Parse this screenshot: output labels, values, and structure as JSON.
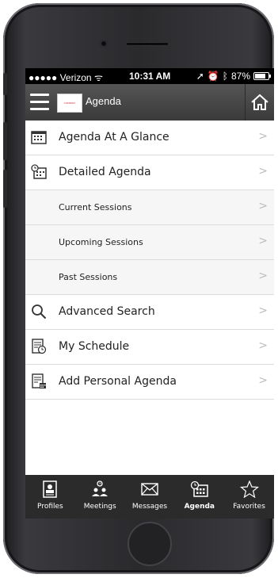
{
  "status_bar": {
    "carrier": "●●●●● Verizon",
    "time": "10:31 AM",
    "battery": "87%"
  },
  "header": {
    "title": "Agenda",
    "logo_text": "COMPANY"
  },
  "menu": {
    "items": [
      {
        "label": "Agenda At A Glance",
        "icon": "calendar-grid-icon",
        "sub": false
      },
      {
        "label": "Detailed Agenda",
        "icon": "calendar-clock-icon",
        "sub": false
      },
      {
        "label": "Current Sessions",
        "icon": "",
        "sub": true
      },
      {
        "label": "Upcoming Sessions",
        "icon": "",
        "sub": true
      },
      {
        "label": "Past Sessions",
        "icon": "",
        "sub": true
      },
      {
        "label": "Advanced Search",
        "icon": "search-icon",
        "sub": false
      },
      {
        "label": "My Schedule",
        "icon": "schedule-icon",
        "sub": false
      },
      {
        "label": "Add Personal Agenda",
        "icon": "add-agenda-icon",
        "sub": false
      }
    ],
    "chevron": ">"
  },
  "tabs": [
    {
      "label": "Profiles",
      "icon": "profile-card-icon",
      "active": false
    },
    {
      "label": "Meetings",
      "icon": "meetings-icon",
      "active": false
    },
    {
      "label": "Messages",
      "icon": "envelope-icon",
      "active": false
    },
    {
      "label": "Agenda",
      "icon": "agenda-icon",
      "active": true
    },
    {
      "label": "Favorites",
      "icon": "star-icon",
      "active": false
    }
  ]
}
